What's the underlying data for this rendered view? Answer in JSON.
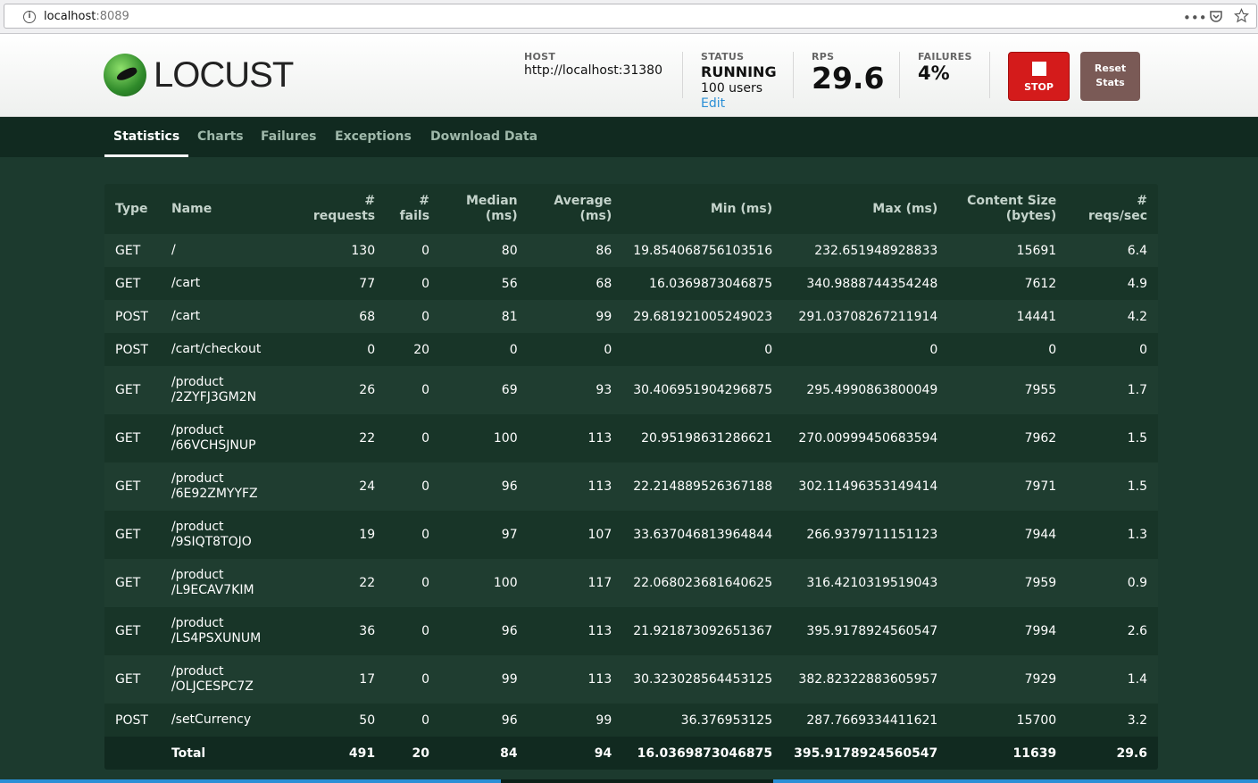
{
  "browser": {
    "url_host": "localhost",
    "url_port": ":8089"
  },
  "header": {
    "logo_text": "LOCUST",
    "host_label": "HOST",
    "host_value": "http://localhost:31380",
    "status_label": "STATUS",
    "status_value": "RUNNING",
    "users_value": "100 users",
    "edit_label": "Edit",
    "rps_label": "RPS",
    "rps_value": "29.6",
    "failures_label": "FAILURES",
    "failures_value": "4%",
    "stop_label": "STOP",
    "reset_label_line1": "Reset",
    "reset_label_line2": "Stats"
  },
  "nav": {
    "tabs": [
      "Statistics",
      "Charts",
      "Failures",
      "Exceptions",
      "Download Data"
    ],
    "active": "Statistics"
  },
  "table": {
    "headers": {
      "type": "Type",
      "name": "Name",
      "requests": [
        "#",
        "requests"
      ],
      "fails": [
        "#",
        "fails"
      ],
      "median": [
        "Median",
        "(ms)"
      ],
      "average": [
        "Average",
        "(ms)"
      ],
      "min": "Min (ms)",
      "max": "Max (ms)",
      "size": [
        "Content Size",
        "(bytes)"
      ],
      "rps": [
        "#",
        "reqs/sec"
      ]
    },
    "rows": [
      {
        "type": "GET",
        "name": [
          "/"
        ],
        "requests": "130",
        "fails": "0",
        "median": "80",
        "average": "86",
        "min": "19.854068756103516",
        "max": "232.651948928833",
        "size": "15691",
        "rps": "6.4"
      },
      {
        "type": "GET",
        "name": [
          "/cart"
        ],
        "requests": "77",
        "fails": "0",
        "median": "56",
        "average": "68",
        "min": "16.0369873046875",
        "max": "340.9888744354248",
        "size": "7612",
        "rps": "4.9"
      },
      {
        "type": "POST",
        "name": [
          "/cart"
        ],
        "requests": "68",
        "fails": "0",
        "median": "81",
        "average": "99",
        "min": "29.681921005249023",
        "max": "291.03708267211914",
        "size": "14441",
        "rps": "4.2"
      },
      {
        "type": "POST",
        "name": [
          "/cart/checkout"
        ],
        "requests": "0",
        "fails": "20",
        "median": "0",
        "average": "0",
        "min": "0",
        "max": "0",
        "size": "0",
        "rps": "0"
      },
      {
        "type": "GET",
        "name": [
          "/product",
          "/2ZYFJ3GM2N"
        ],
        "requests": "26",
        "fails": "0",
        "median": "69",
        "average": "93",
        "min": "30.406951904296875",
        "max": "295.4990863800049",
        "size": "7955",
        "rps": "1.7"
      },
      {
        "type": "GET",
        "name": [
          "/product",
          "/66VCHSJNUP"
        ],
        "requests": "22",
        "fails": "0",
        "median": "100",
        "average": "113",
        "min": "20.95198631286621",
        "max": "270.00999450683594",
        "size": "7962",
        "rps": "1.5"
      },
      {
        "type": "GET",
        "name": [
          "/product",
          "/6E92ZMYYFZ"
        ],
        "requests": "24",
        "fails": "0",
        "median": "96",
        "average": "113",
        "min": "22.214889526367188",
        "max": "302.11496353149414",
        "size": "7971",
        "rps": "1.5"
      },
      {
        "type": "GET",
        "name": [
          "/product",
          "/9SIQT8TOJO"
        ],
        "requests": "19",
        "fails": "0",
        "median": "97",
        "average": "107",
        "min": "33.637046813964844",
        "max": "266.9379711151123",
        "size": "7944",
        "rps": "1.3"
      },
      {
        "type": "GET",
        "name": [
          "/product",
          "/L9ECAV7KIM"
        ],
        "requests": "22",
        "fails": "0",
        "median": "100",
        "average": "117",
        "min": "22.068023681640625",
        "max": "316.4210319519043",
        "size": "7959",
        "rps": "0.9"
      },
      {
        "type": "GET",
        "name": [
          "/product",
          "/LS4PSXUNUM"
        ],
        "requests": "36",
        "fails": "0",
        "median": "96",
        "average": "113",
        "min": "21.921873092651367",
        "max": "395.9178924560547",
        "size": "7994",
        "rps": "2.6"
      },
      {
        "type": "GET",
        "name": [
          "/product",
          "/OLJCESPC7Z"
        ],
        "requests": "17",
        "fails": "0",
        "median": "99",
        "average": "113",
        "min": "30.323028564453125",
        "max": "382.82322883605957",
        "size": "7929",
        "rps": "1.4"
      },
      {
        "type": "POST",
        "name": [
          "/setCurrency"
        ],
        "requests": "50",
        "fails": "0",
        "median": "96",
        "average": "99",
        "min": "36.376953125",
        "max": "287.7669334411621",
        "size": "15700",
        "rps": "3.2"
      }
    ],
    "total": {
      "type": "",
      "name": "Total",
      "requests": "491",
      "fails": "20",
      "median": "84",
      "average": "94",
      "min": "16.0369873046875",
      "max": "395.9178924560547",
      "size": "11639",
      "rps": "29.6"
    }
  },
  "colors": {
    "background": "#1c3a2e",
    "nav": "#112a20",
    "stop_button": "#d41b1b",
    "reset_button": "#7a5a56",
    "link": "#2a8fd6"
  }
}
